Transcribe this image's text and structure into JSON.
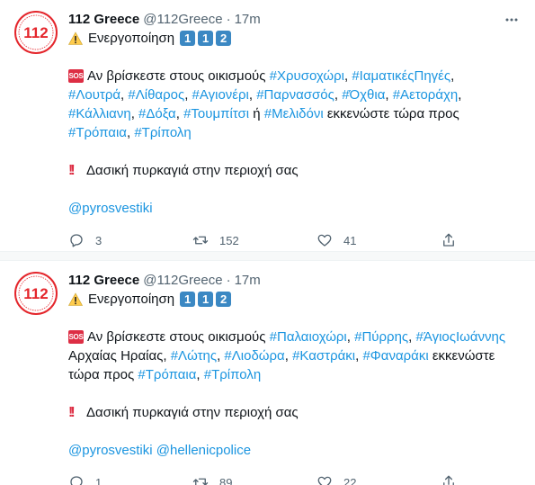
{
  "tweets": [
    {
      "name": "112 Greece",
      "handle": "@112Greece",
      "dot": "·",
      "time": "17m",
      "avatar_text": "112",
      "activation_label": "Ενεργοποίηση",
      "keycaps": [
        "1",
        "1",
        "2"
      ],
      "sos": "SOS",
      "line1_prefix": "Αν βρίσκεστε στους οικισμούς",
      "line1_tags": [
        "#Χρυσοχώρι",
        "#ΙαματικέςΠηγές"
      ],
      "line2_tags": [
        "#Λουτρά",
        "#Λίθαρος",
        "#Αγιονέρι",
        "#Παρνασσός",
        "#Όχθια",
        "#Αετοράχη"
      ],
      "line3_tags": [
        "#Κάλλιανη",
        "#Δόξα",
        "#Τουμπίτσι"
      ],
      "line3_or": "ή",
      "line3_tag_last": "#Μελιδόνι",
      "line3_suffix": "εκκενώστε τώρα προς",
      "line4_tags": [
        "#Τρόπαια",
        "#Τρίπολη"
      ],
      "bangs": "!!",
      "warning_text": "Δασική πυρκαγιά στην περιοχή σας",
      "mentions": [
        "@pyrosvestiki"
      ],
      "replies": "3",
      "retweets": "152",
      "likes": "41"
    },
    {
      "name": "112 Greece",
      "handle": "@112Greece",
      "dot": "·",
      "time": "17m",
      "avatar_text": "112",
      "activation_label": "Ενεργοποίηση",
      "keycaps": [
        "1",
        "1",
        "2"
      ],
      "sos": "SOS",
      "line1_prefix": "Αν βρίσκεστε στους οικισμούς",
      "line1_tags": [
        "#Παλαιοχώρι",
        "#Πύρρης",
        "#ΆγιοςΙωάννης"
      ],
      "line2_prefix": "Αρχαίας Ηραίας,",
      "line2_tags": [
        "#Λώτης",
        "#Λιοδώρα",
        "#Καστράκι",
        "#Φαναράκι"
      ],
      "line2_suffix": "εκκενώστε",
      "line3_prefix": "τώρα προς",
      "line3_tags": [
        "#Τρόπαια",
        "#Τρίπολη"
      ],
      "bangs": "!!",
      "warning_text": "Δασική πυρκαγιά στην περιοχή σας",
      "mentions": [
        "@pyrosvestiki",
        "@hellenicpolice"
      ],
      "replies": "1",
      "retweets": "89",
      "likes": "22"
    }
  ],
  "colors": {
    "hashtag": "#1b95e0",
    "muted": "#536471",
    "avatar_red": "#e4262c",
    "keycap_blue": "#3b88c3",
    "sos_red": "#dd2e44"
  },
  "icons": [
    "avatar-logo-icon",
    "more-options-icon",
    "warning-icon",
    "sos-icon",
    "reply-icon",
    "retweet-icon",
    "like-icon",
    "share-icon"
  ]
}
